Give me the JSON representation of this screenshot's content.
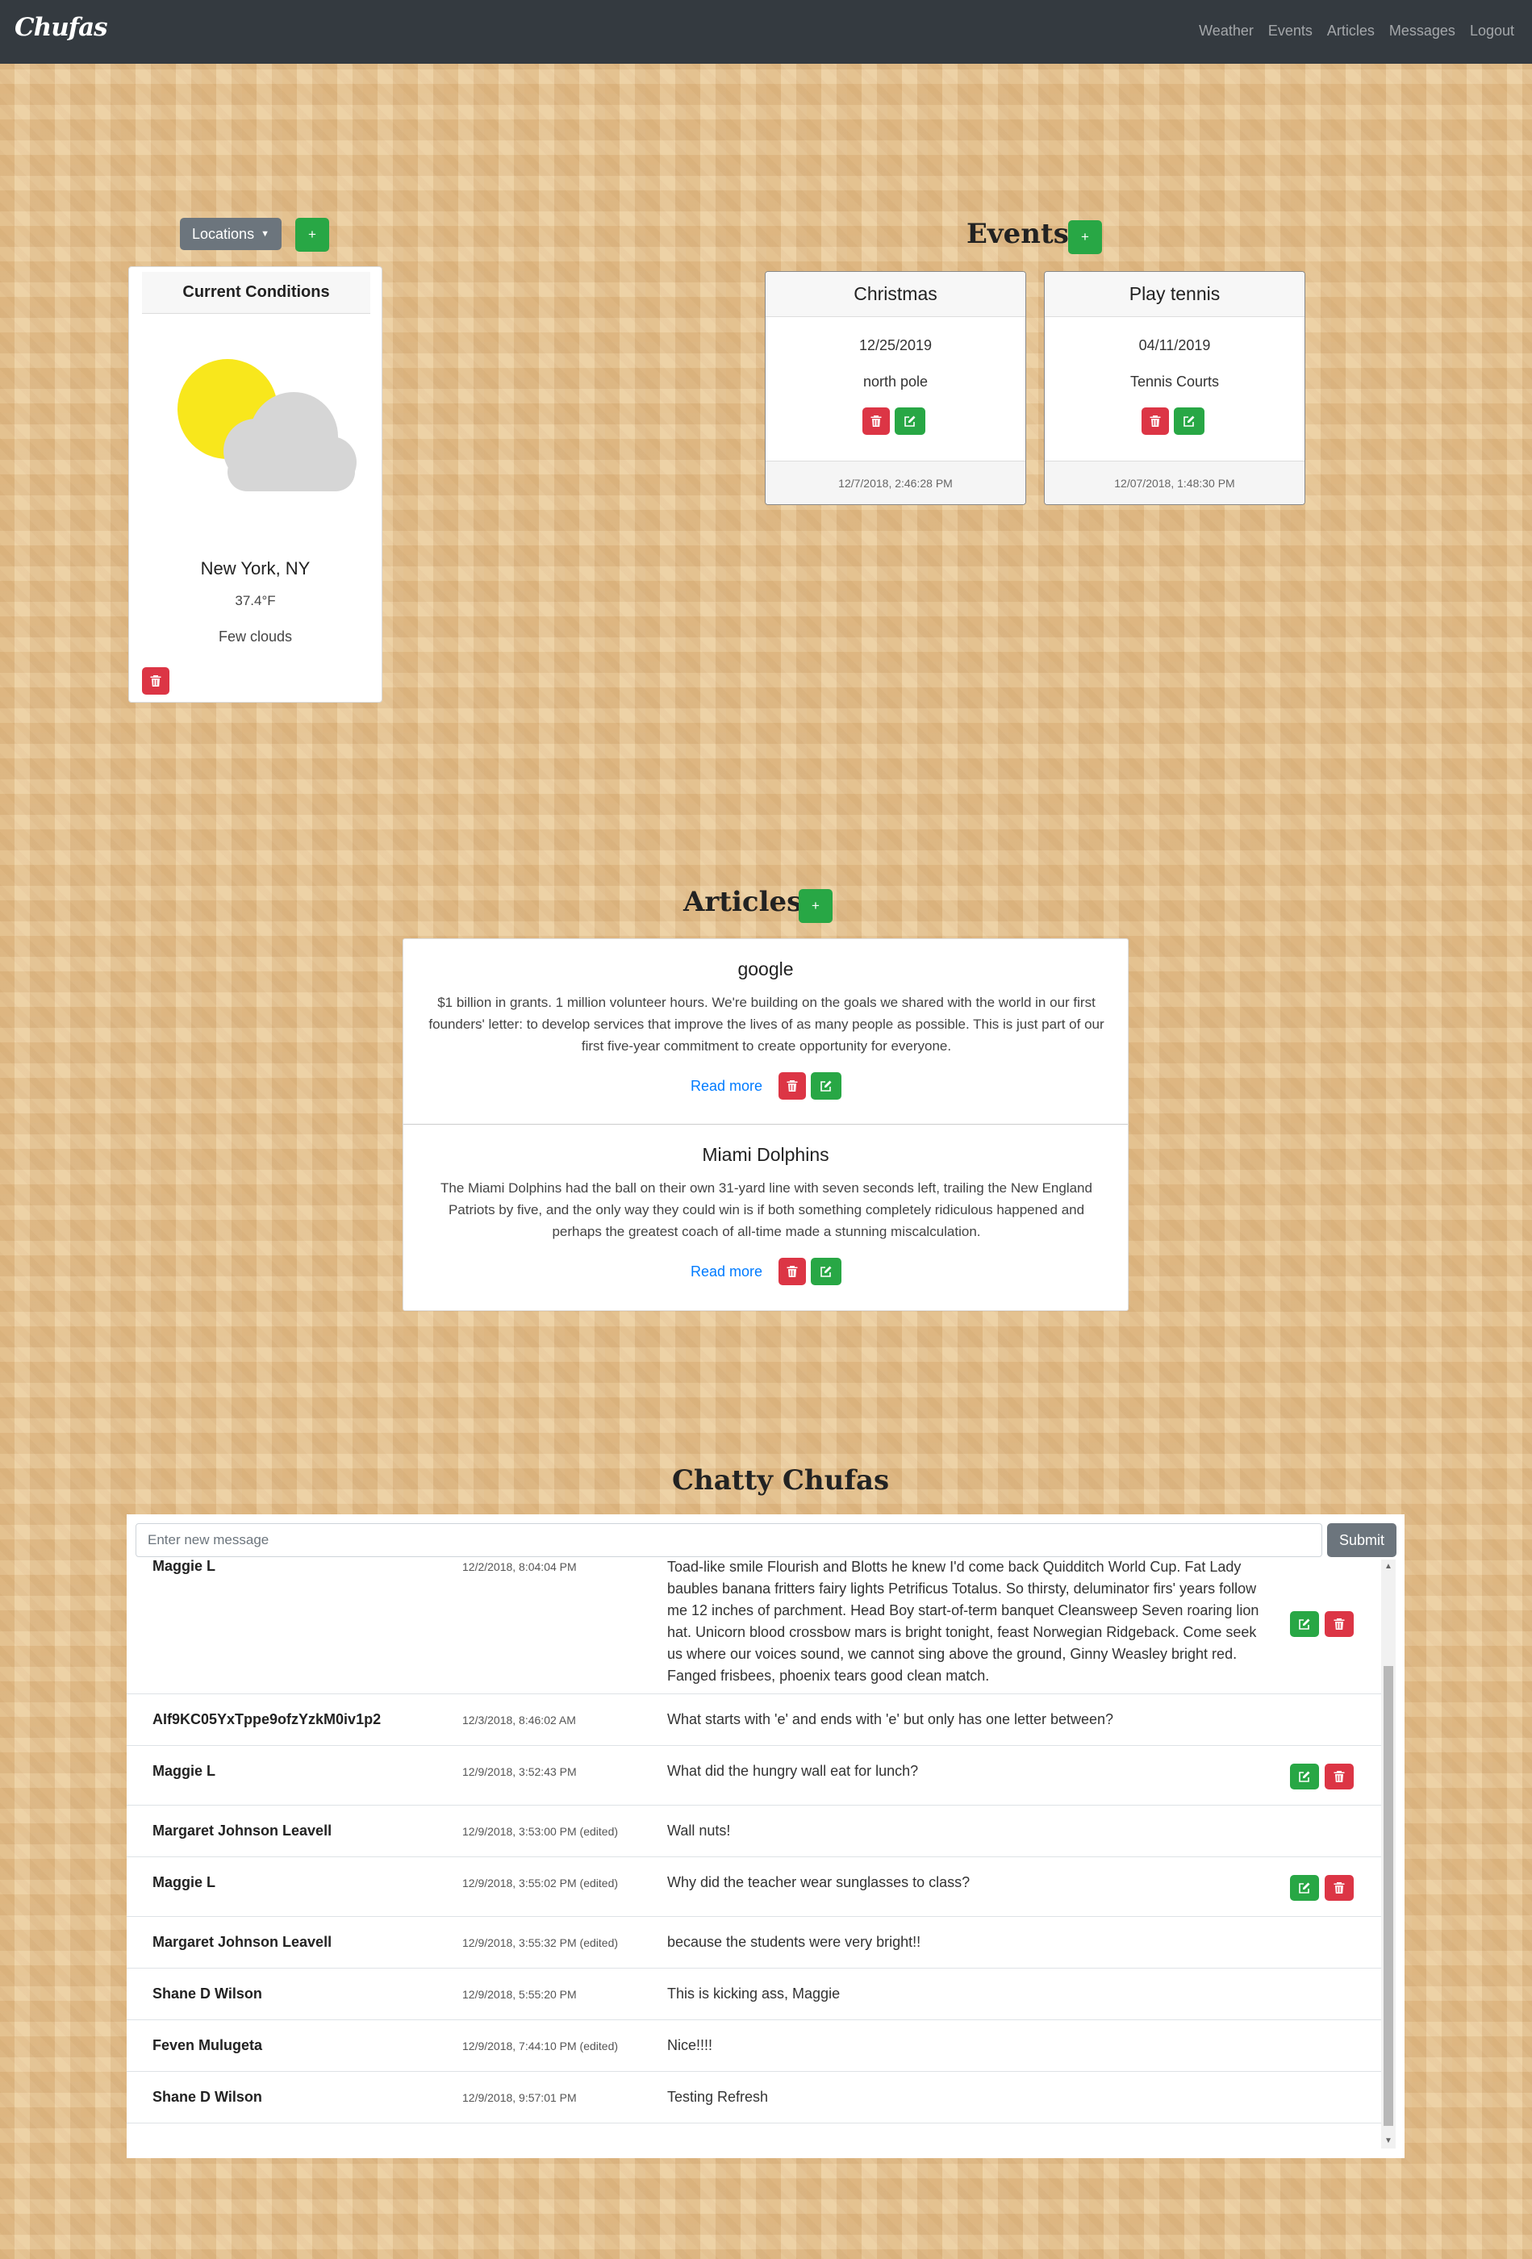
{
  "navbar": {
    "brand": "Chufas",
    "links": [
      "Weather",
      "Events",
      "Articles",
      "Messages",
      "Logout"
    ]
  },
  "weather": {
    "locations_label": "Locations",
    "add_label": "+",
    "header": "Current Conditions",
    "icon": "partly-cloudy-icon",
    "city": "New York, NY",
    "temperature": "37.4°F",
    "description": "Few clouds"
  },
  "events": {
    "title": "Events",
    "add_label": "+",
    "items": [
      {
        "title": "Christmas",
        "date": "12/25/2019",
        "location": "north pole",
        "created": "12/7/2018, 2:46:28 PM"
      },
      {
        "title": "Play tennis",
        "date": "04/11/2019",
        "location": "Tennis Courts",
        "created": "12/07/2018, 1:48:30 PM"
      }
    ]
  },
  "articles": {
    "title": "Articles",
    "add_label": "+",
    "items": [
      {
        "title": "google",
        "body": "$1 billion in grants. 1 million volunteer hours. We're building on the goals we shared with the world in our first founders' letter: to develop services that improve the lives of as many people as possible. This is just part of our first five-year commitment to create opportunity for everyone.",
        "read_more": "Read more"
      },
      {
        "title": "Miami Dolphins",
        "body": "The Miami Dolphins had the ball on their own 31-yard line with seven seconds left, trailing the New England Patriots by five, and the only way they could win is if both something completely ridiculous happened and perhaps the greatest coach of all-time made a stunning miscalculation.",
        "read_more": "Read more"
      }
    ]
  },
  "chat": {
    "title": "Chatty Chufas",
    "placeholder": "Enter new message",
    "submit_label": "Submit",
    "messages": [
      {
        "name": "Maggie L",
        "date": "12/2/2018, 8:04:04 PM",
        "text": "Toad-like smile Flourish and Blotts he knew I'd come back Quidditch World Cup. Fat Lady baubles banana fritters fairy lights Petrificus Totalus. So thirsty, deluminator firs' years follow me 12 inches of parchment. Head Boy start-of-term banquet Cleansweep Seven roaring lion hat. Unicorn blood crossbow mars is bright tonight, feast Norwegian Ridgeback. Come seek us where our voices sound, we cannot sing above the ground, Ginny Weasley bright red. Fanged frisbees, phoenix tears good clean match."
      },
      {
        "name": "AIf9KC05YxTppe9ofzYzkM0iv1p2",
        "date": "12/3/2018, 8:46:02 AM",
        "text": "What starts with 'e' and ends with 'e' but only has one letter between?"
      },
      {
        "name": "Maggie L",
        "date": "12/9/2018, 3:52:43 PM",
        "text": "What did the hungry wall eat for lunch?"
      },
      {
        "name": "Margaret Johnson Leavell",
        "date": "12/9/2018, 3:53:00 PM (edited)",
        "text": "Wall nuts!"
      },
      {
        "name": "Maggie L",
        "date": "12/9/2018, 3:55:02 PM (edited)",
        "text": "Why did the teacher wear sunglasses to class?"
      },
      {
        "name": "Margaret Johnson Leavell",
        "date": "12/9/2018, 3:55:32 PM (edited)",
        "text": "because the students were very bright!!"
      },
      {
        "name": "Shane D Wilson",
        "date": "12/9/2018, 5:55:20 PM",
        "text": "This is kicking ass, Maggie"
      },
      {
        "name": "Feven Mulugeta",
        "date": "12/9/2018, 7:44:10 PM (edited)",
        "text": "Nice!!!!"
      },
      {
        "name": "Shane D Wilson",
        "date": "12/9/2018, 9:57:01 PM",
        "text": "Testing Refresh"
      }
    ]
  },
  "colors": {
    "navbar": "#343a40",
    "success": "#28a745",
    "danger": "#dc3545",
    "secondary": "#6c757d",
    "link": "#007bff"
  }
}
